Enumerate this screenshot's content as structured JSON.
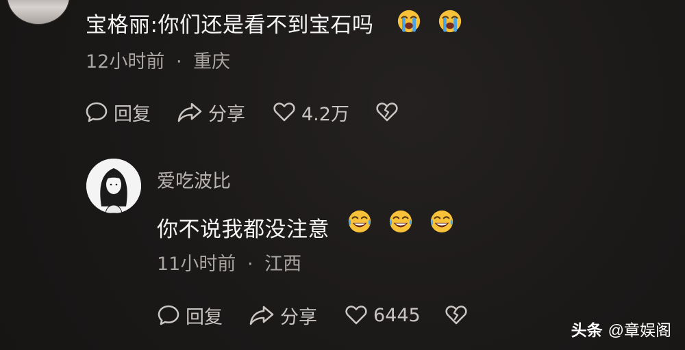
{
  "comment": {
    "text": "宝格丽:你们还是看不到宝石吗",
    "emojis": [
      "loudly-crying-face",
      "loudly-crying-face"
    ],
    "time": "12小时前",
    "dot": "·",
    "location": "重庆",
    "actions": {
      "reply_label": "回复",
      "share_label": "分享",
      "like_count": "4.2万"
    }
  },
  "reply": {
    "username": "爱吃波比",
    "text": "你不说我都没注意",
    "emojis": [
      "tears-of-joy-face",
      "tears-of-joy-face",
      "tears-of-joy-face"
    ],
    "time": "11小时前",
    "dot": "·",
    "location": "江西",
    "actions": {
      "reply_label": "回复",
      "share_label": "分享",
      "like_count": "6445"
    }
  },
  "watermark": {
    "brand": "头条",
    "handle": "@章娱阁"
  },
  "colors": {
    "background": "#1b1918",
    "primary_text": "#f5f5f5",
    "secondary_text": "#a9a5a3",
    "emoji_yellow": "#f7c23a",
    "emoji_tear": "#4aa3e6"
  }
}
